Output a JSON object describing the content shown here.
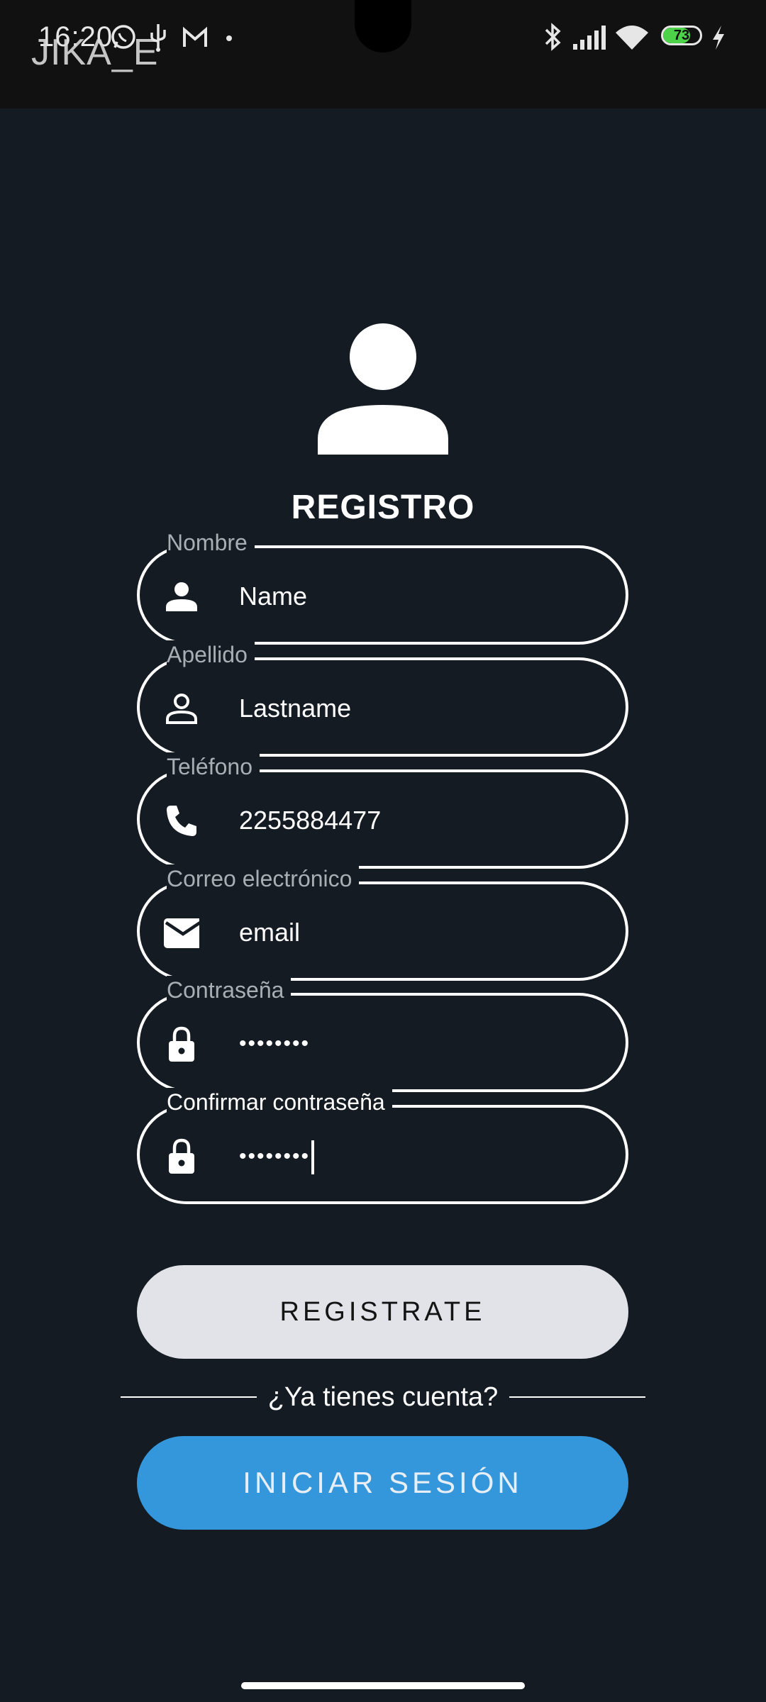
{
  "status_bar": {
    "time": "16:20",
    "app_title": "JIKA_E",
    "battery_level": "73",
    "battery_fraction": 0.73
  },
  "register": {
    "heading": "REGISTRO",
    "fields": [
      {
        "label": "Nombre",
        "value": "Name",
        "icon": "person-icon"
      },
      {
        "label": "Apellido",
        "value": "Lastname",
        "icon": "person-outline-icon"
      },
      {
        "label": "Teléfono",
        "value": "2255884477",
        "icon": "phone-icon"
      },
      {
        "label": "Correo electrónico",
        "value": "email",
        "icon": "mail-icon"
      },
      {
        "label": "Contraseña",
        "value": "••••••••",
        "icon": "lock-icon"
      },
      {
        "label": "Confirmar contraseña",
        "value": "••••••••",
        "icon": "lock-icon"
      }
    ],
    "register_button": "REGISTRATE",
    "has_account_text": "¿Ya tienes cuenta?",
    "login_button": "INICIAR SESIÓN"
  },
  "colors": {
    "background": "#141b22",
    "accent": "#3597db",
    "register_button": "#e1e3e8"
  }
}
